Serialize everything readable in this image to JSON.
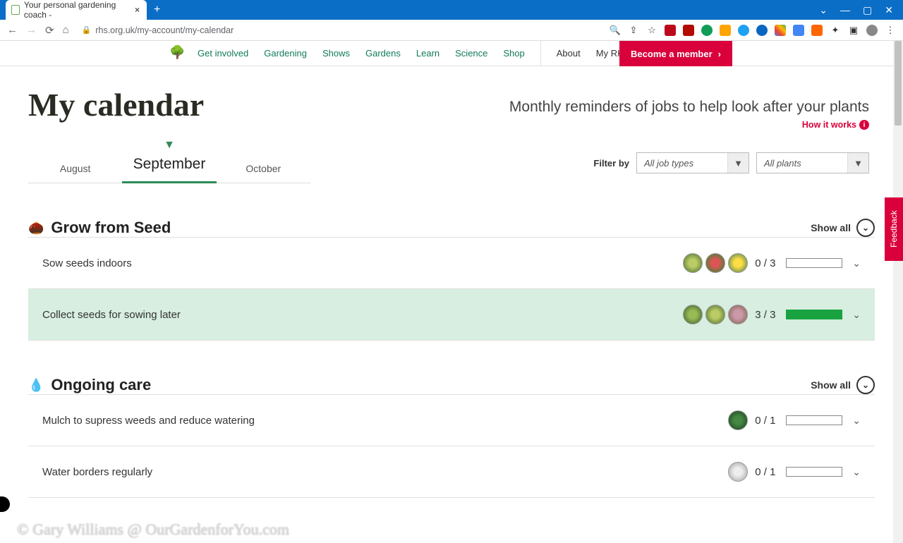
{
  "browser": {
    "tab_title": "Your personal gardening coach -",
    "url": "rhs.org.uk/my-account/my-calendar"
  },
  "nav": {
    "links": [
      "Get involved",
      "Gardening",
      "Shows",
      "Gardens",
      "Learn",
      "Science",
      "Shop"
    ],
    "about": "About",
    "myrhs": "My RHS",
    "cta": "Become a member"
  },
  "page": {
    "title": "My calendar",
    "subtitle": "Monthly reminders of jobs to help look after your plants",
    "how_it_works": "How it works"
  },
  "months": {
    "prev": "August",
    "current": "September",
    "next": "October"
  },
  "filter": {
    "label": "Filter by",
    "job_types": "All job types",
    "plants": "All plants"
  },
  "sections": [
    {
      "title": "Grow from Seed",
      "show_all": "Show all",
      "tasks": [
        {
          "title": "Sow seeds indoors",
          "count": "0 / 3",
          "done": false,
          "thumbs": 3
        },
        {
          "title": "Collect seeds for sowing later",
          "count": "3 / 3",
          "done": true,
          "thumbs": 3
        }
      ]
    },
    {
      "title": "Ongoing care",
      "show_all": "Show all",
      "tasks": [
        {
          "title": "Mulch to supress weeds and reduce watering",
          "count": "0 / 1",
          "done": false,
          "thumbs": 1
        },
        {
          "title": "Water borders regularly",
          "count": "0 / 1",
          "done": false,
          "thumbs": 1
        }
      ]
    }
  ],
  "feedback": "Feedback",
  "watermark": "© Gary Williams @ OurGardenforYou.com"
}
